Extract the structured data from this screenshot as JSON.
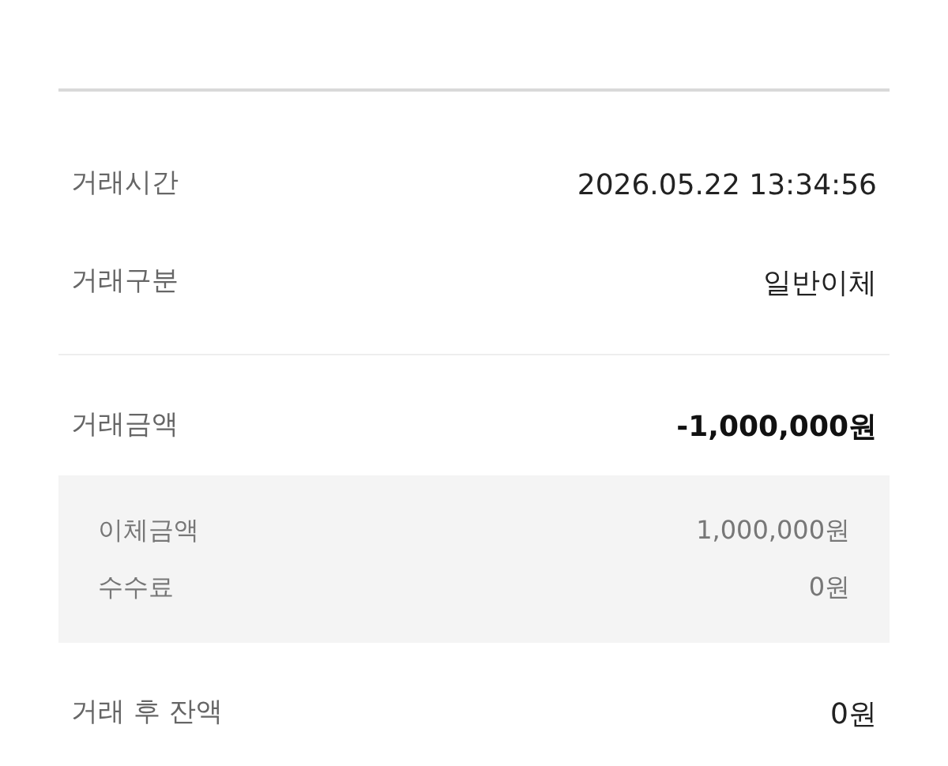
{
  "info_rows": [
    {
      "label": "거래시간",
      "value": "2026.05.22 13:34:56"
    },
    {
      "label": "거래구분",
      "value": "일반이체"
    }
  ],
  "amount": {
    "label": "거래금액",
    "value": "-1,000,000원"
  },
  "breakdown": [
    {
      "label": "이체금액",
      "value": "1,000,000원"
    },
    {
      "label": "수수료",
      "value": "0원"
    }
  ],
  "balance": {
    "label": "거래 후 잔액",
    "value": "0원"
  }
}
